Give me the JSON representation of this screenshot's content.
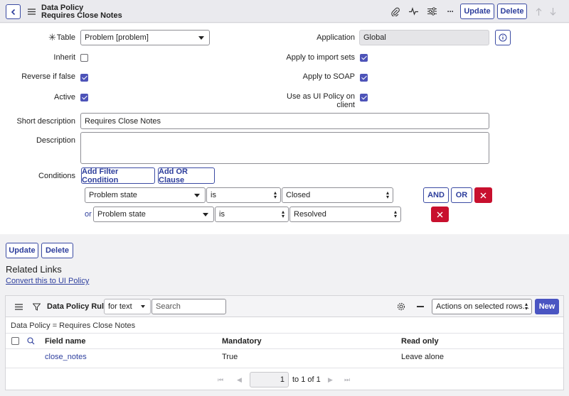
{
  "header": {
    "title": "Data Policy",
    "subtitle": "Requires Close Notes",
    "update_label": "Update",
    "delete_label": "Delete"
  },
  "form": {
    "table_label": "Table",
    "table_value": "Problem [problem]",
    "application_label": "Application",
    "application_value": "Global",
    "inherit_label": "Inherit",
    "inherit_checked": false,
    "apply_import_label": "Apply to import sets",
    "apply_import_checked": true,
    "reverse_label": "Reverse if false",
    "reverse_checked": true,
    "apply_soap_label": "Apply to SOAP",
    "apply_soap_checked": true,
    "active_label": "Active",
    "active_checked": true,
    "ui_policy_label_line1": "Use as UI Policy on",
    "ui_policy_label_line2": "client",
    "ui_policy_checked": true,
    "short_desc_label": "Short description",
    "short_desc_value": "Requires Close Notes",
    "description_label": "Description",
    "description_value": "",
    "conditions_label": "Conditions",
    "add_filter_label": "Add Filter Condition",
    "add_or_label": "Add OR Clause",
    "cond1": {
      "field": "Problem state",
      "op": "is",
      "value": "Closed"
    },
    "cond2": {
      "prefix": "or",
      "field": "Problem state",
      "op": "is",
      "value": "Resolved"
    },
    "and_label": "AND",
    "or_label": "OR"
  },
  "bottom": {
    "update_label": "Update",
    "delete_label": "Delete",
    "related_links_title": "Related Links",
    "convert_link": "Convert this to UI Policy"
  },
  "related_list": {
    "title": "Data Policy Rules",
    "search_type": "for text",
    "search_placeholder": "Search",
    "actions_label": "Actions on selected rows...",
    "new_label": "New",
    "breadcrumb": "Data Policy = Requires Close Notes",
    "columns": [
      "Field name",
      "Mandatory",
      "Read only"
    ],
    "rows": [
      {
        "field": "close_notes",
        "mandatory": "True",
        "read_only": "Leave alone"
      }
    ],
    "page_current": "1",
    "page_info": "to 1 of 1"
  },
  "colors": {
    "accent": "#2d3e9c",
    "checkbox": "#4d53b8",
    "danger": "#c8102e"
  }
}
